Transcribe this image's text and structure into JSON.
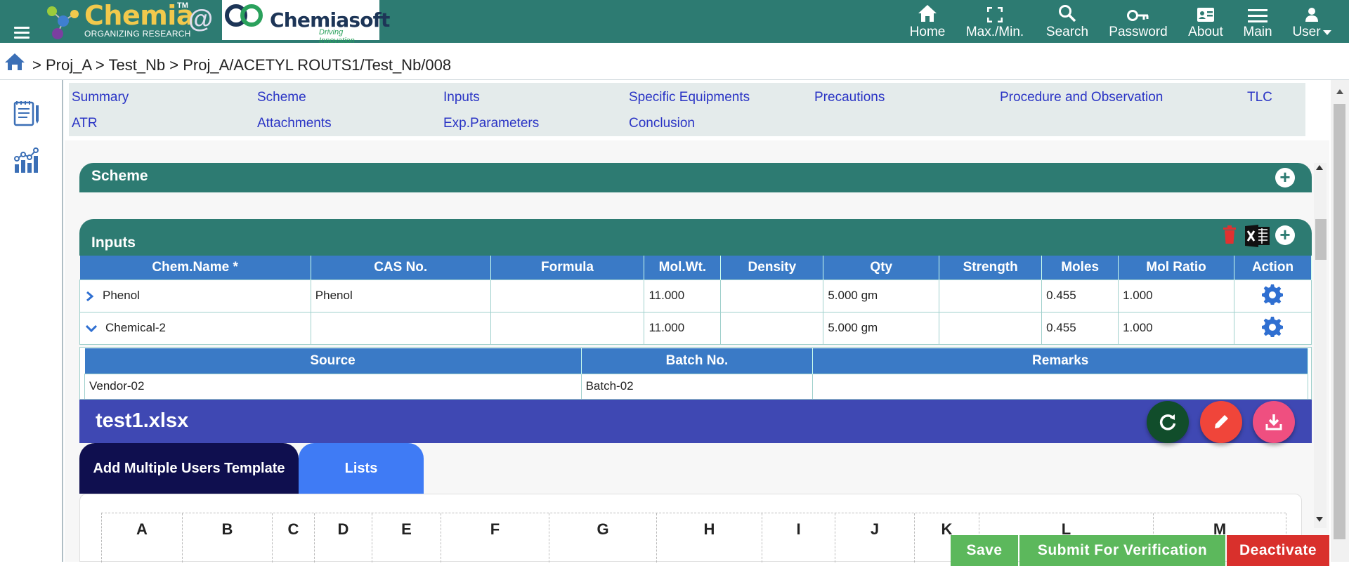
{
  "header": {
    "brand": "Chemia",
    "brand_tm": "TM",
    "brand_sub": "ORGANIZING RESEARCH",
    "at": "@",
    "partner": "Chemiasoft",
    "partner_tag": "Driving Innovation",
    "nav": [
      {
        "label": "Home",
        "icon": "home-icon"
      },
      {
        "label": "Max./Min.",
        "icon": "maximize-icon"
      },
      {
        "label": "Search",
        "icon": "search-icon"
      },
      {
        "label": "Password",
        "icon": "key-icon"
      },
      {
        "label": "About",
        "icon": "id-card-icon"
      },
      {
        "label": "Main",
        "icon": "menu-icon"
      },
      {
        "label": "User",
        "icon": "user-icon"
      }
    ]
  },
  "breadcrumb": "> Proj_A > Test_Nb > Proj_A/ACETYL ROUTS1/Test_Nb/008",
  "tabs": [
    [
      "Summary",
      "Scheme",
      "Inputs",
      "Specific Equipments",
      "Precautions",
      "Procedure and Observation",
      "TLC"
    ],
    [
      "ATR",
      "Attachments",
      "Exp.Parameters",
      "Conclusion"
    ]
  ],
  "sections": {
    "scheme": "Scheme",
    "inputs": "Inputs"
  },
  "inputs_table": {
    "columns": [
      "Chem.Name *",
      "CAS No.",
      "Formula",
      "Mol.Wt.",
      "Density",
      "Qty",
      "Strength",
      "Moles",
      "Mol Ratio",
      "Action"
    ],
    "rows": [
      {
        "name": "Phenol",
        "cas": "Phenol",
        "formula": "",
        "molwt": "11.000",
        "density": "",
        "qty": "5.000 gm",
        "strength": "",
        "moles": "0.455",
        "ratio": "1.000"
      },
      {
        "name": "Chemical-2",
        "cas": "",
        "formula": "",
        "molwt": "11.000",
        "density": "",
        "qty": "5.000 gm",
        "strength": "",
        "moles": "0.455",
        "ratio": "1.000"
      }
    ]
  },
  "sub_table": {
    "columns": [
      "Source",
      "Batch No.",
      "Remarks"
    ],
    "row": [
      "Vendor-02",
      "Batch-02",
      ""
    ]
  },
  "file": {
    "name": "test1.xlsx",
    "sheets": [
      "Add Multiple Users Template",
      "Lists"
    ],
    "col_letters": [
      "A",
      "B",
      "C",
      "D",
      "E",
      "F",
      "G",
      "H",
      "I",
      "J",
      "K",
      "L",
      "M"
    ]
  },
  "actions": {
    "save": "Save",
    "submit": "Submit For Verification",
    "deactivate": "Deactivate"
  },
  "colors": {
    "header": "#2d7b72",
    "table_header": "#3a7ac6",
    "file_bar": "#3f48b3",
    "save": "#5cb85c",
    "deactivate": "#d9302c"
  }
}
